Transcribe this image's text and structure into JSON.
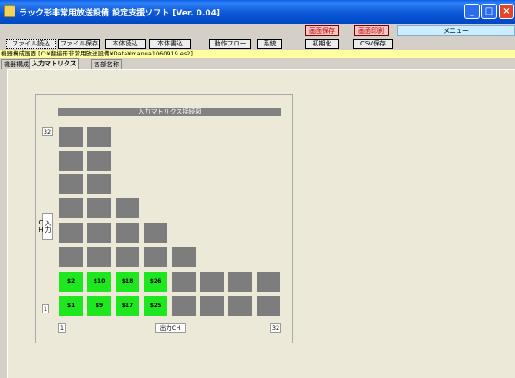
{
  "window": {
    "title": "ラック形非常用放送設備 設定支援ソフト [Ver. 0.04]"
  },
  "header": {
    "save_screen": "画面保存",
    "print_screen": "画面印刷",
    "menu": "メニュー"
  },
  "toolbar": {
    "file_read": "ファイル読込",
    "file_save": "ファイル保存",
    "body_read": "本体読込",
    "body_write": "本体書込",
    "action_flow": "動作フロー",
    "system": "系統",
    "initialize": "初期化",
    "csv_save": "CSV保存"
  },
  "pathbar": {
    "label": "機器構成画面",
    "path": "[C:¥翻接形非常用放送設備¥Data¥manua1060919.es2]"
  },
  "tabs": [
    "機器構成",
    "入力マトリクス",
    "各部名称"
  ],
  "matrix": {
    "title": "入力マトリクス接続図",
    "y_top": "32",
    "y_bottom": "1",
    "y_label": "入力CH",
    "x_left": "1",
    "x_right": "32",
    "x_label": "出力CH",
    "green_row2": [
      "$2",
      "$10",
      "$18",
      "$26"
    ],
    "green_row1": [
      "$1",
      "$9",
      "$17",
      "$25"
    ]
  },
  "colors": {
    "titlebar": "#0b58d8",
    "active_cell": "#1fe71f",
    "inactive_cell": "#7d7d7d",
    "pathbar": "#ffffa0",
    "menu": "#ccecff"
  }
}
